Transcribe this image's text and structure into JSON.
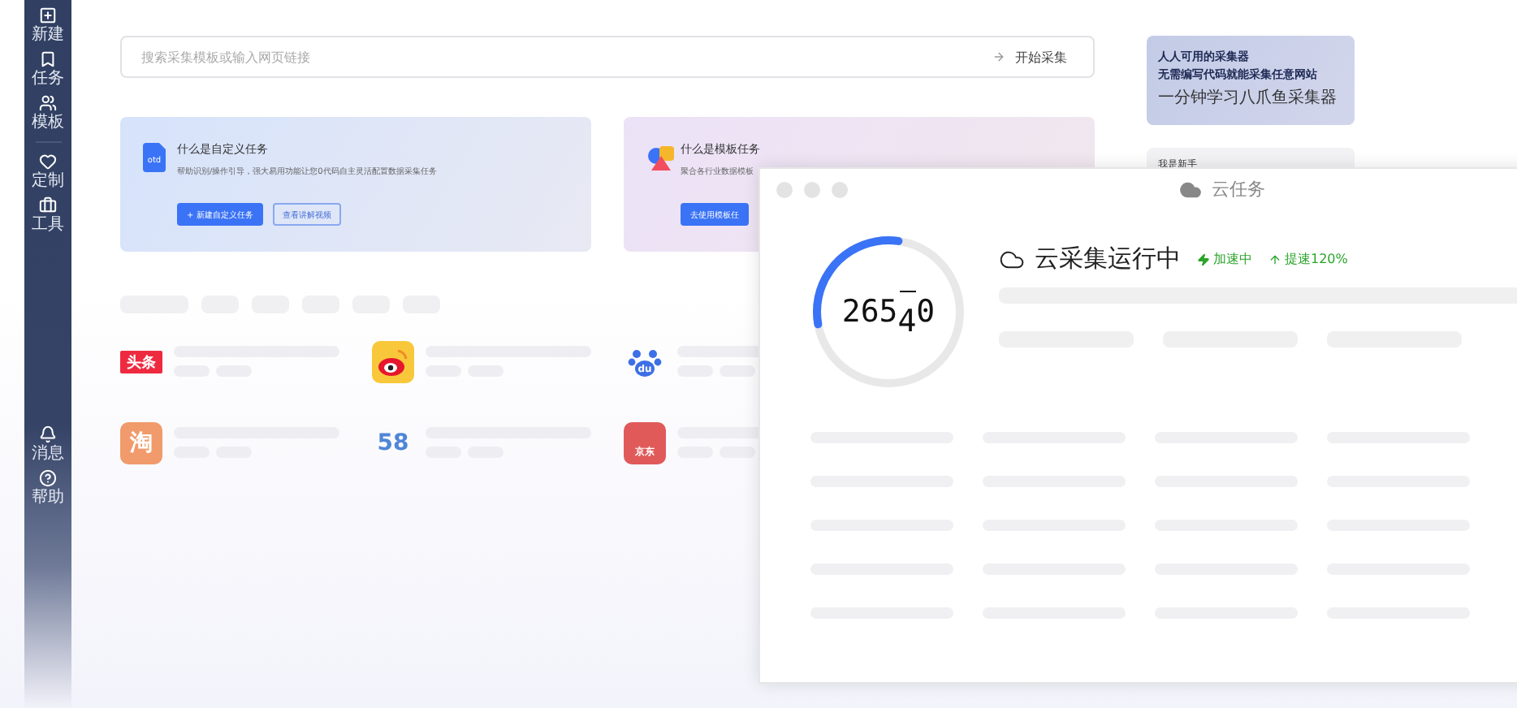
{
  "sidebar": {
    "items": [
      {
        "kind": "new",
        "label": "新建"
      },
      {
        "kind": "task",
        "label": "任务"
      },
      {
        "kind": "template",
        "label": "模板"
      },
      {
        "kind": "custom",
        "label": "定制"
      },
      {
        "kind": "tools",
        "label": "工具"
      }
    ],
    "bottom_items": [
      {
        "kind": "bell",
        "label": "消息"
      },
      {
        "kind": "help",
        "label": "帮助"
      }
    ]
  },
  "search": {
    "placeholder": "搜索采集模板或输入网页链接",
    "button": "开始采集"
  },
  "cards": [
    {
      "kind": "custom",
      "icon_text": "otd",
      "title": "什么是自定义任务",
      "description": "帮助识别/操作引导，强大易用功能让您0代码自主灵活配置数据采集任务",
      "primary": "+ 新建自定义任务",
      "secondary": "查看讲解视频"
    },
    {
      "kind": "template",
      "title": "什么是模板任务",
      "description": "聚合各行业数据模板",
      "primary": "去使用模板任"
    }
  ],
  "promo": {
    "line_1": "人人可用的采集器",
    "line_2": "无需编写代码就能采集任意网站",
    "caption": "一分钟学习八爪鱼采集器"
  },
  "newbie": {
    "title": "我是新手"
  },
  "sites": [
    {
      "kind": "toutiao",
      "text": "头条"
    },
    {
      "kind": "weibo"
    },
    {
      "kind": "baidu",
      "text": "du"
    },
    {
      "kind": "taobao",
      "text": "淘"
    },
    {
      "kind": "fiftyeight",
      "text": "58"
    },
    {
      "kind": "jd",
      "text": "京东"
    }
  ],
  "cloud_window": {
    "title": "云任务",
    "status": "云采集运行中",
    "badges": [
      {
        "kind": "bolt",
        "label": "加速中"
      },
      {
        "kind": "up",
        "label": "提速120%"
      }
    ],
    "progress": {
      "level": 0.3
    },
    "counter": {
      "before": "265",
      "rolling": "4",
      "after": "0"
    }
  }
}
